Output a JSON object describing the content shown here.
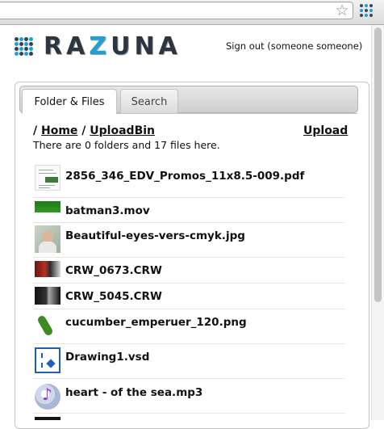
{
  "browser": {
    "star_glyph": "☆",
    "extension_icon": "dot-grid-icon"
  },
  "header": {
    "logo_text_main_1": "RA",
    "logo_text_accent": "Z",
    "logo_text_main_2": "UNA",
    "signout_label": "Sign out (someone someone)"
  },
  "tabs": [
    {
      "label": "Folder & Files",
      "active": true
    },
    {
      "label": "Search",
      "active": false
    }
  ],
  "breadcrumb": {
    "separator": "/",
    "home": "Home",
    "current": "UploadBin"
  },
  "actions": {
    "upload_label": "Upload"
  },
  "summary": "There are 0 folders and 17 files here.",
  "files": [
    {
      "name": "2856_346_EDV_Promos_11x8.5-009.pdf",
      "thumb": "pdf-thumbnail"
    },
    {
      "name": "batman3.mov",
      "thumb": "video-thumbnail"
    },
    {
      "name": "Beautiful-eyes-vers-cmyk.jpg",
      "thumb": "photo-thumbnail"
    },
    {
      "name": "CRW_0673.CRW",
      "thumb": "raw-photo-thumbnail"
    },
    {
      "name": "CRW_5045.CRW",
      "thumb": "raw-photo-thumbnail"
    },
    {
      "name": "cucumber_emperuer_120.png",
      "thumb": "image-thumbnail"
    },
    {
      "name": "Drawing1.vsd",
      "thumb": "visio-icon"
    },
    {
      "name": "heart - of the sea.mp3",
      "thumb": "audio-icon"
    }
  ],
  "colors": {
    "brand_accent": "#1d9fd8",
    "brand_dark": "#2d3640"
  }
}
